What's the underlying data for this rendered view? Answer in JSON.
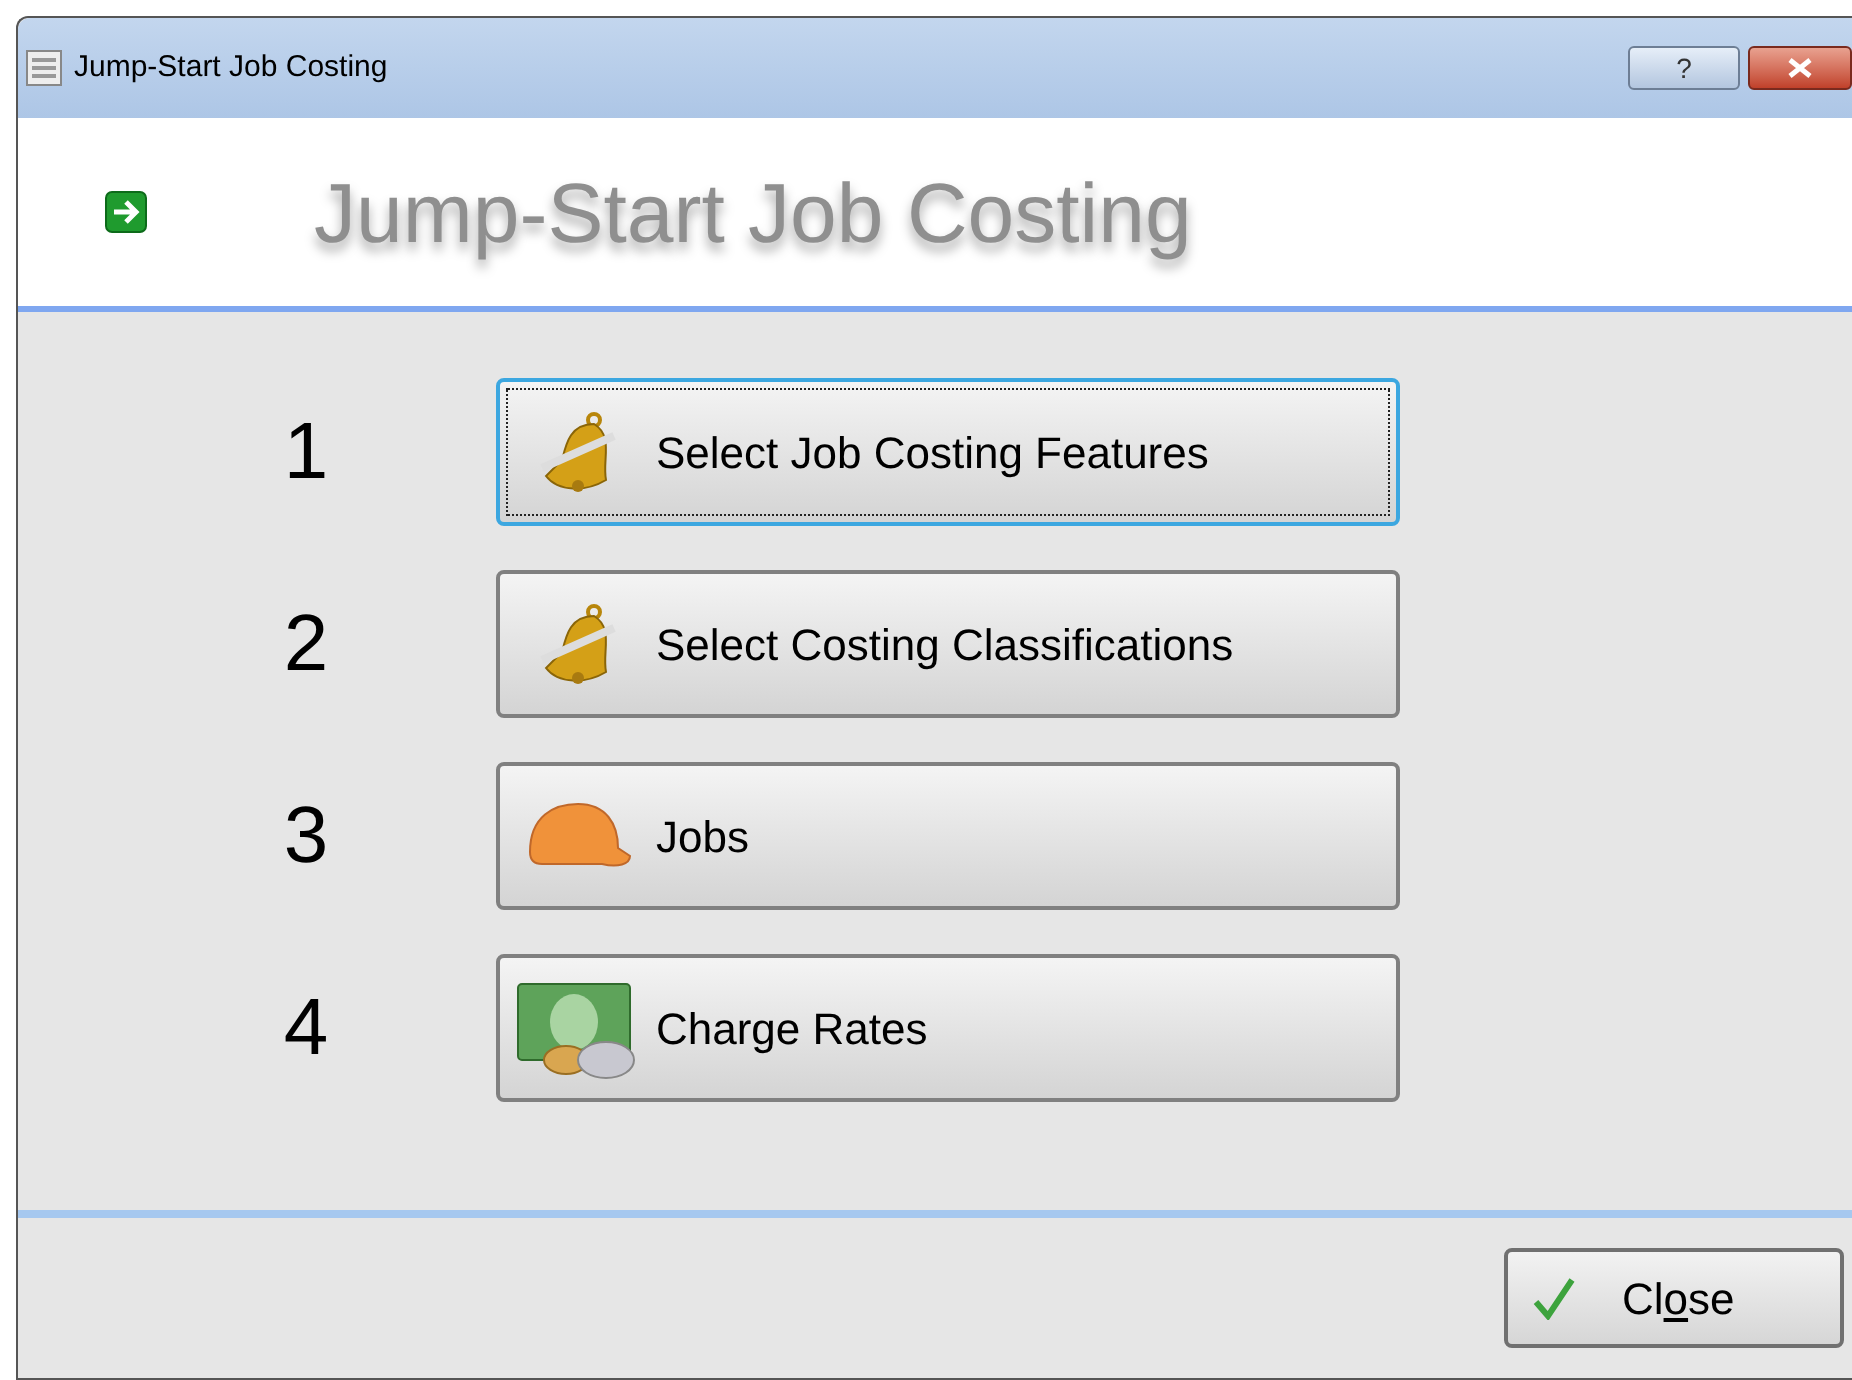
{
  "window": {
    "title": "Jump-Start Job Costing",
    "help_button": "?"
  },
  "header": {
    "title": "Jump-Start Job Costing"
  },
  "steps": [
    {
      "number": "1",
      "label": "Select Job Costing Features",
      "kind": "bell",
      "focused": true
    },
    {
      "number": "2",
      "label": "Select Costing Classifications",
      "kind": "bell",
      "focused": false
    },
    {
      "number": "3",
      "label": "Jobs",
      "kind": "hardhat",
      "focused": false
    },
    {
      "number": "4",
      "label": "Charge Rates",
      "kind": "money",
      "focused": false
    }
  ],
  "close_button": {
    "label_before": "Cl",
    "access_key": "o",
    "label_after": "se"
  }
}
